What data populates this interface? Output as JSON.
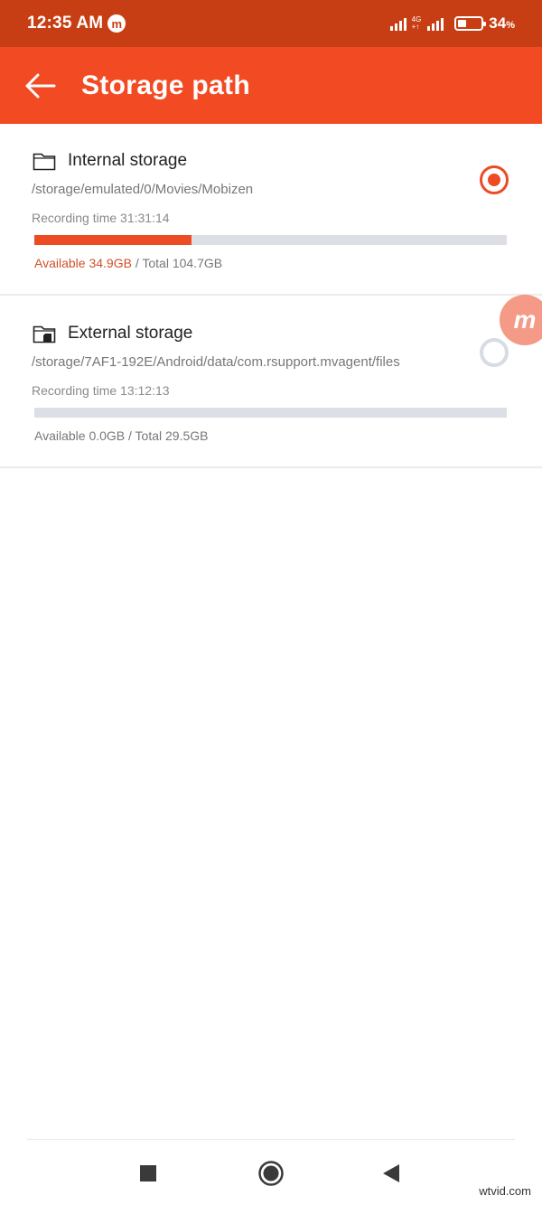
{
  "status_bar": {
    "time": "12:35 AM",
    "app_icon_letter": "m",
    "network_label_top": "4G",
    "network_label_bottom": "+↑",
    "battery_percent": "34",
    "battery_unit": "%"
  },
  "toolbar": {
    "title": "Storage path"
  },
  "storage_items": [
    {
      "title": "Internal storage",
      "path": "/storage/emulated/0/Movies/Mobizen",
      "recording_time": "Recording time 31:31:14",
      "available": "Available 34.9GB",
      "total": " / Total 104.7GB",
      "used_fraction": 0.333,
      "selected": true
    },
    {
      "title": "External storage",
      "path": "/storage/7AF1-192E/Android/data/com.rsupport.mvagent/files",
      "recording_time": "Recording time 13:12:13",
      "available": "Available 0.0GB",
      "total": " / Total 29.5GB",
      "used_fraction": 0.0,
      "selected": false
    }
  ],
  "floating_bubble": {
    "letter": "m"
  },
  "watermark": "wtvid.com",
  "colors": {
    "status_bar": "#c83e14",
    "toolbar": "#f24a23",
    "accent": "#ec4b24",
    "track": "#dcdfe5"
  }
}
